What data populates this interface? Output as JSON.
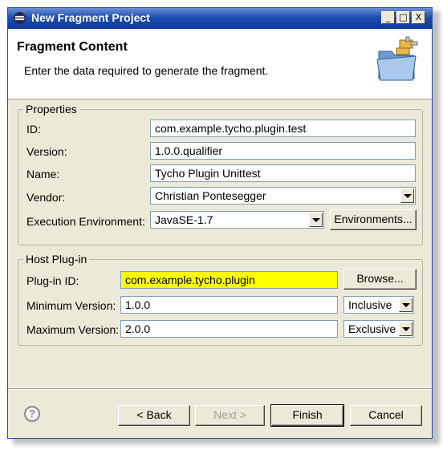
{
  "window": {
    "title": "New Fragment Project",
    "controls": [
      "_",
      "□",
      "X"
    ]
  },
  "header": {
    "title": "Fragment Content",
    "description": "Enter the data required to generate the fragment."
  },
  "properties": {
    "legend": "Properties",
    "id_label": "ID:",
    "id_value": "com.example.tycho.plugin.test",
    "version_label": "Version:",
    "version_value": "1.0.0.qualifier",
    "name_label": "Name:",
    "name_value": "Tycho Plugin Unittest",
    "vendor_label": "Vendor:",
    "vendor_value": "Christian Pontesegger",
    "env_label": "Execution Environment:",
    "env_value": "JavaSE-1.7",
    "env_button": "Environments..."
  },
  "host": {
    "legend": "Host Plug-in",
    "plugin_label": "Plug-in ID:",
    "plugin_value": "com.example.tycho.plugin",
    "browse_button": "Browse...",
    "min_label": "Minimum Version:",
    "min_value": "1.0.0",
    "min_mode": "Inclusive",
    "max_label": "Maximum Version:",
    "max_value": "2.0.0",
    "max_mode": "Exclusive"
  },
  "footer": {
    "back": "< Back",
    "next": "Next >",
    "finish": "Finish",
    "cancel": "Cancel"
  },
  "colors": {
    "highlight_field": "#ffff00",
    "title_bar": "#1b4db0"
  }
}
